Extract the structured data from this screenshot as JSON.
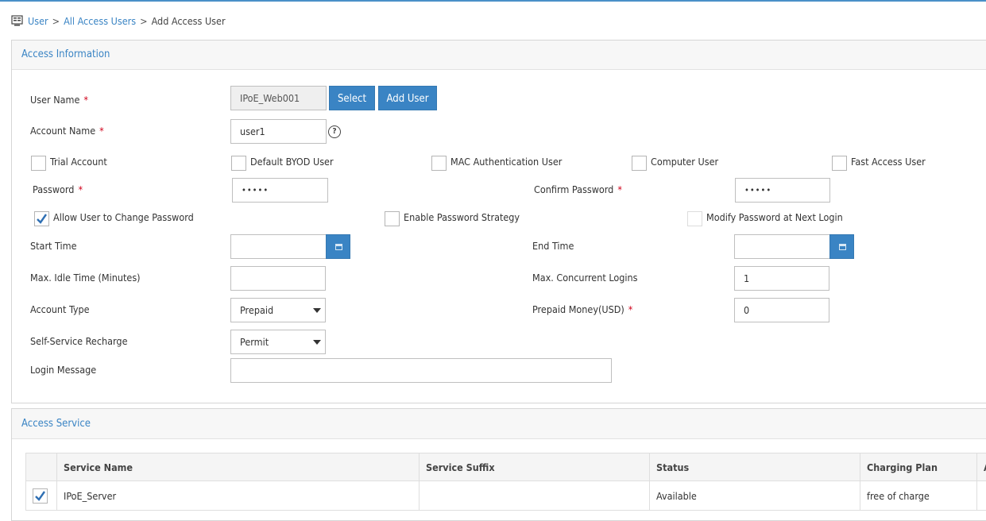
{
  "breadcrumb": {
    "icon": "user-list-icon",
    "items": [
      "User",
      "All Access Users"
    ],
    "current": "Add Access User"
  },
  "access_information": {
    "title": "Access Information",
    "user_name": {
      "label": "User Name",
      "required": "*",
      "value": "IPoE_Web001"
    },
    "select_button": "Select",
    "add_user_button": "Add User",
    "account_name": {
      "label": "Account Name",
      "required": "*",
      "value": "user1",
      "help_icon": "question-circle-icon"
    },
    "options": [
      {
        "label": "Trial Account",
        "checked": false
      },
      {
        "label": "Default BYOD User",
        "checked": false
      },
      {
        "label": "MAC Authentication User",
        "checked": false
      },
      {
        "label": "Computer User",
        "checked": false
      },
      {
        "label": "Fast Access User",
        "checked": false
      }
    ],
    "password": {
      "label": "Password",
      "required": "*",
      "value": "•••••"
    },
    "confirm_password": {
      "label": "Confirm Password",
      "required": "*",
      "value": "•••••"
    },
    "password_options": [
      {
        "label": "Allow User to Change Password",
        "checked": true
      },
      {
        "label": "Enable Password Strategy",
        "checked": false
      },
      {
        "label": "Modify Password at Next Login",
        "checked": false
      }
    ],
    "start_time": {
      "label": "Start Time",
      "value": "",
      "icon": "calendar-icon"
    },
    "end_time": {
      "label": "End Time",
      "value": "",
      "icon": "calendar-icon"
    },
    "max_idle_time": {
      "label": "Max. Idle Time (Minutes)",
      "value": ""
    },
    "max_concurrent_logins": {
      "label": "Max. Concurrent Logins",
      "value": "1"
    },
    "account_type": {
      "label": "Account Type",
      "value": "Prepaid"
    },
    "prepaid_money": {
      "label": "Prepaid Money(USD)",
      "required": "*",
      "value": "0"
    },
    "self_service_recharge": {
      "label": "Self-Service Recharge",
      "value": "Permit"
    },
    "login_message": {
      "label": "Login Message",
      "value": ""
    }
  },
  "access_service": {
    "title": "Access Service",
    "columns": [
      "Service Name",
      "Service Suffix",
      "Status",
      "Charging Plan",
      "A"
    ],
    "rows": [
      {
        "checked": true,
        "service_name": "IPoE_Server",
        "service_suffix": "",
        "status": "Available",
        "charging_plan": "free of charge",
        "extra": ""
      }
    ]
  },
  "colors": {
    "accent": "#3a84c4",
    "required": "#d0021b"
  }
}
